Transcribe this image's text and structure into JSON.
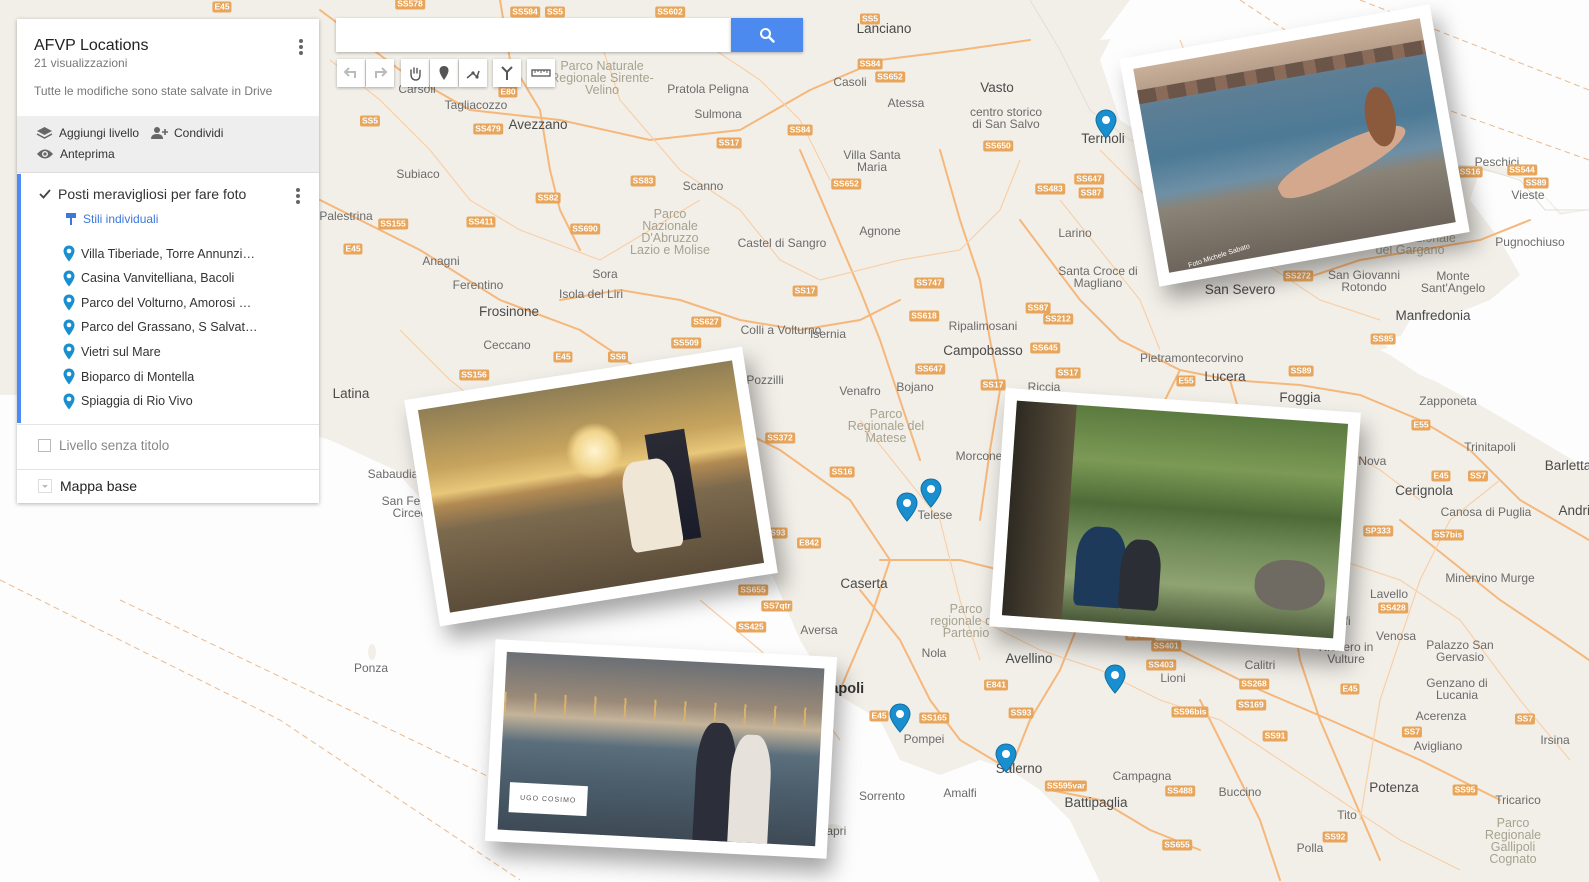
{
  "panel": {
    "title": "AFVP Locations",
    "views": "21 visualizzazioni",
    "saved_status": "Tutte le modifiche sono state salvate in Drive",
    "add_layer": "Aggiungi livello",
    "share": "Condividi",
    "preview": "Anteprima",
    "layer1": {
      "name": "Posti meravigliosi per fare foto",
      "style": "Stili individuali",
      "items": [
        "Villa Tiberiade, Torre Annunzi…",
        "Casina Vanvitelliana, Bacoli",
        "Parco del Volturno, Amorosi …",
        "Parco del Grassano, S Salvat…",
        "Vietri sul Mare",
        "Bioparco di Montella",
        "Spiaggia di Rio Vivo"
      ]
    },
    "layer2_name": "Livello senza titolo",
    "base_map": "Mappa base"
  },
  "search": {
    "value": ""
  },
  "icons": [
    "search-icon",
    "undo-icon",
    "redo-icon",
    "hand-icon",
    "marker-icon",
    "draw-line-icon",
    "route-icon",
    "ruler-icon",
    "layers-icon",
    "add-person-icon",
    "eye-icon",
    "checkbox-icon",
    "paint-icon",
    "pin-icon",
    "more-vert-icon",
    "dropdown-icon"
  ],
  "colors": {
    "accent": "#4d8af0",
    "pin": "#1a8fcf",
    "layer_bar": "#4c8bf5",
    "land": "#f2efe9",
    "sea": "#ffffff",
    "roads": "#f6b77b"
  },
  "map": {
    "places": [
      {
        "t": "Lanciano",
        "c": "city"
      },
      {
        "t": "Vasto",
        "c": "city"
      },
      {
        "t": "Atessa",
        "c": ""
      },
      {
        "t": "centro storico di San Salvo",
        "c": ""
      },
      {
        "t": "Termoli",
        "c": "city"
      },
      {
        "t": "Casoli",
        "c": ""
      },
      {
        "t": "Pratola Peligna",
        "c": ""
      },
      {
        "t": "Sulmona",
        "c": ""
      },
      {
        "t": "Avezzano",
        "c": "city"
      },
      {
        "t": "Tagliacozzo",
        "c": ""
      },
      {
        "t": "Carsoli",
        "c": ""
      },
      {
        "t": "Villa Santa Maria",
        "c": ""
      },
      {
        "t": "Scanno",
        "c": ""
      },
      {
        "t": "Subiaco",
        "c": ""
      },
      {
        "t": "Palestrina",
        "c": ""
      },
      {
        "t": "Anagni",
        "c": ""
      },
      {
        "t": "Sora",
        "c": ""
      },
      {
        "t": "Ferentino",
        "c": ""
      },
      {
        "t": "Isola del Liri",
        "c": ""
      },
      {
        "t": "Frosinone",
        "c": "city"
      },
      {
        "t": "Castel di Sangro",
        "c": ""
      },
      {
        "t": "Agnone",
        "c": ""
      },
      {
        "t": "Larino",
        "c": ""
      },
      {
        "t": "Santa Croce di Magliano",
        "c": ""
      },
      {
        "t": "San Severo",
        "c": "city"
      },
      {
        "t": "San Giovanni Rotondo",
        "c": ""
      },
      {
        "t": "Monte Sant'Angelo",
        "c": ""
      },
      {
        "t": "Manfredonia",
        "c": "city"
      },
      {
        "t": "Vieste",
        "c": ""
      },
      {
        "t": "Peschici",
        "c": ""
      },
      {
        "t": "Pugnochiuso",
        "c": ""
      },
      {
        "t": "Ripalimosani",
        "c": ""
      },
      {
        "t": "Campobasso",
        "c": "city"
      },
      {
        "t": "Pietramontecorvino",
        "c": ""
      },
      {
        "t": "Lucera",
        "c": "city"
      },
      {
        "t": "Foggia",
        "c": "city"
      },
      {
        "t": "Zapponeta",
        "c": ""
      },
      {
        "t": "Colli a Volturno",
        "c": ""
      },
      {
        "t": "Isernia",
        "c": ""
      },
      {
        "t": "Ceccano",
        "c": ""
      },
      {
        "t": "Pozzilli",
        "c": ""
      },
      {
        "t": "Venafro",
        "c": ""
      },
      {
        "t": "Bojano",
        "c": ""
      },
      {
        "t": "Riccia",
        "c": ""
      },
      {
        "t": "Latina",
        "c": "city"
      },
      {
        "t": "Sabaudia",
        "c": ""
      },
      {
        "t": "San Felice Circeo",
        "c": ""
      },
      {
        "t": "Morcone",
        "c": ""
      },
      {
        "t": "Telese",
        "c": ""
      },
      {
        "t": "Caserta",
        "c": "city"
      },
      {
        "t": "Aversa",
        "c": ""
      },
      {
        "t": "Nola",
        "c": ""
      },
      {
        "t": "Avellino",
        "c": "city"
      },
      {
        "t": "Napoli",
        "c": "big"
      },
      {
        "t": "Pompei",
        "c": ""
      },
      {
        "t": "Sorrento",
        "c": ""
      },
      {
        "t": "Amalfi",
        "c": ""
      },
      {
        "t": "Salerno",
        "c": "city"
      },
      {
        "t": "Capri",
        "c": ""
      },
      {
        "t": "Ponza",
        "c": ""
      },
      {
        "t": "Battipaglia",
        "c": "city"
      },
      {
        "t": "Campagna",
        "c": ""
      },
      {
        "t": "Lioni",
        "c": ""
      },
      {
        "t": "Calitri",
        "c": ""
      },
      {
        "t": "Melfi",
        "c": ""
      },
      {
        "t": "Rionero in Vulture",
        "c": ""
      },
      {
        "t": "Venosa",
        "c": ""
      },
      {
        "t": "Lavello",
        "c": ""
      },
      {
        "t": "Cerignola",
        "c": "city"
      },
      {
        "t": "Orta Nova",
        "c": ""
      },
      {
        "t": "Trinitapoli",
        "c": ""
      },
      {
        "t": "Canosa di Puglia",
        "c": ""
      },
      {
        "t": "Minervino Murge",
        "c": ""
      },
      {
        "t": "Palazzo San Gervasio",
        "c": ""
      },
      {
        "t": "Genzano di Lucania",
        "c": ""
      },
      {
        "t": "Acerenza",
        "c": ""
      },
      {
        "t": "Avigliano",
        "c": ""
      },
      {
        "t": "Potenza",
        "c": "city"
      },
      {
        "t": "Buccino",
        "c": ""
      },
      {
        "t": "Tito",
        "c": ""
      },
      {
        "t": "Tricarico",
        "c": ""
      },
      {
        "t": "Irsina",
        "c": ""
      },
      {
        "t": "Polla",
        "c": ""
      },
      {
        "t": "Barletta",
        "c": "city"
      },
      {
        "t": "Andria",
        "c": "city"
      }
    ],
    "parks": [
      "Parco Naturale Regionale Sirente-Velino",
      "Parco Nazionale D'Abruzzo Lazio e Molise",
      "Parco Nazionale del Gargano",
      "Parco Regionale del Matese",
      "Parco regionale del Partenio",
      "Parco Regionale Gallipoli Cognato"
    ],
    "shields": [
      "E45",
      "SS578",
      "SS584",
      "SS5",
      "SS602",
      "SS84",
      "SS652",
      "SS5",
      "E80",
      "SS479",
      "SS17",
      "SS84",
      "SS650",
      "SS5",
      "SS83",
      "SS82",
      "SS652",
      "SS647",
      "SS87",
      "SS483",
      "SS16",
      "SS89",
      "SS411",
      "SS690",
      "SS155",
      "E45",
      "SS17",
      "SS747",
      "SS87",
      "SS212",
      "SS272",
      "SS627",
      "SS618",
      "SS645",
      "SS509",
      "SS6",
      "SS156",
      "E45",
      "SS647",
      "SS17",
      "SS17",
      "E55",
      "SS89",
      "SS85",
      "SS544",
      "SS372",
      "E55",
      "SS16",
      "E45",
      "SS7",
      "E842",
      "SS93",
      "SP333",
      "SS7bis",
      "SS655",
      "SS7qtr",
      "SS428",
      "SS425",
      "SS400",
      "SS401",
      "SS403",
      "SS268",
      "E841",
      "SS165",
      "SS93",
      "SS96bis",
      "E45",
      "SS7",
      "SS169",
      "E45",
      "SS91",
      "SS7",
      "SS595var",
      "SS488",
      "SS95",
      "SS92",
      "SS655"
    ]
  },
  "watermarks": {
    "photo1": "Foto Michele Sabato",
    "photo4": "UGO COSIMO"
  }
}
